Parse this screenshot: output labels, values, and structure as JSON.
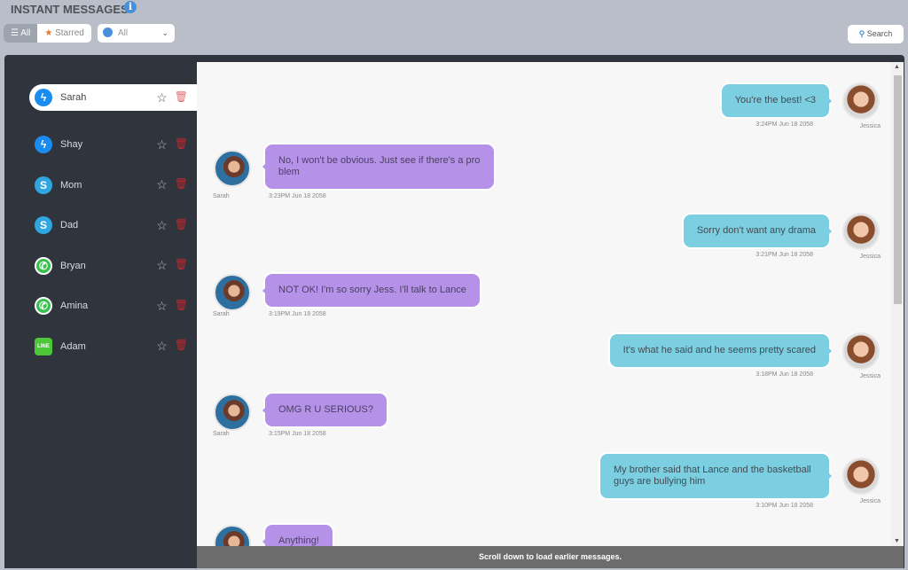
{
  "header": {
    "title": "INSTANT MESSAGES",
    "info_icon": "i"
  },
  "filters": {
    "all_label": "All",
    "starred_label": "Starred",
    "platform_select": "All",
    "search_label": "Search"
  },
  "contacts": [
    {
      "name": "Sarah",
      "app": "messenger",
      "active": true
    },
    {
      "name": "Shay",
      "app": "messenger"
    },
    {
      "name": "Mom",
      "app": "skype"
    },
    {
      "name": "Dad",
      "app": "skype"
    },
    {
      "name": "Bryan",
      "app": "whatsapp"
    },
    {
      "name": "Amina",
      "app": "whatsapp"
    },
    {
      "name": "Adam",
      "app": "line"
    }
  ],
  "messages": [
    {
      "side": "right",
      "sender": "Jessica",
      "text": "You're the best! <3",
      "time": "3:24PM Jun 18 2058"
    },
    {
      "side": "left",
      "sender": "Sarah",
      "text": "No, I won't be obvious. Just see if there's a problem",
      "time": "3:23PM Jun 18 2058"
    },
    {
      "side": "right",
      "sender": "Jessica",
      "text": "Sorry don't want any drama",
      "time": "3:21PM Jun 18 2058"
    },
    {
      "side": "left",
      "sender": "Sarah",
      "text": "NOT OK! I'm so sorry Jess. I'll talk to Lance",
      "time": "3:19PM Jun 18 2058"
    },
    {
      "side": "right",
      "sender": "Jessica",
      "text": "It's what he said and he seems pretty scared",
      "time": "3:18PM Jun 18 2058"
    },
    {
      "side": "left",
      "sender": "Sarah",
      "text": "OMG R U SERIOUS?",
      "time": "3:15PM Jun 18 2058"
    },
    {
      "side": "right",
      "sender": "Jessica",
      "text": "My brother said that Lance and the basketball guys are bullying him",
      "time": "3:10PM Jun 18 2058"
    },
    {
      "side": "left",
      "sender": "Sarah",
      "text": "Anything!",
      "time": ""
    }
  ],
  "footer": {
    "text": "Scroll down to load earlier messages."
  },
  "colors": {
    "outgoing_bubble": "#7ccfe0",
    "incoming_bubble": "#b592e8",
    "panel": "#30353d"
  }
}
